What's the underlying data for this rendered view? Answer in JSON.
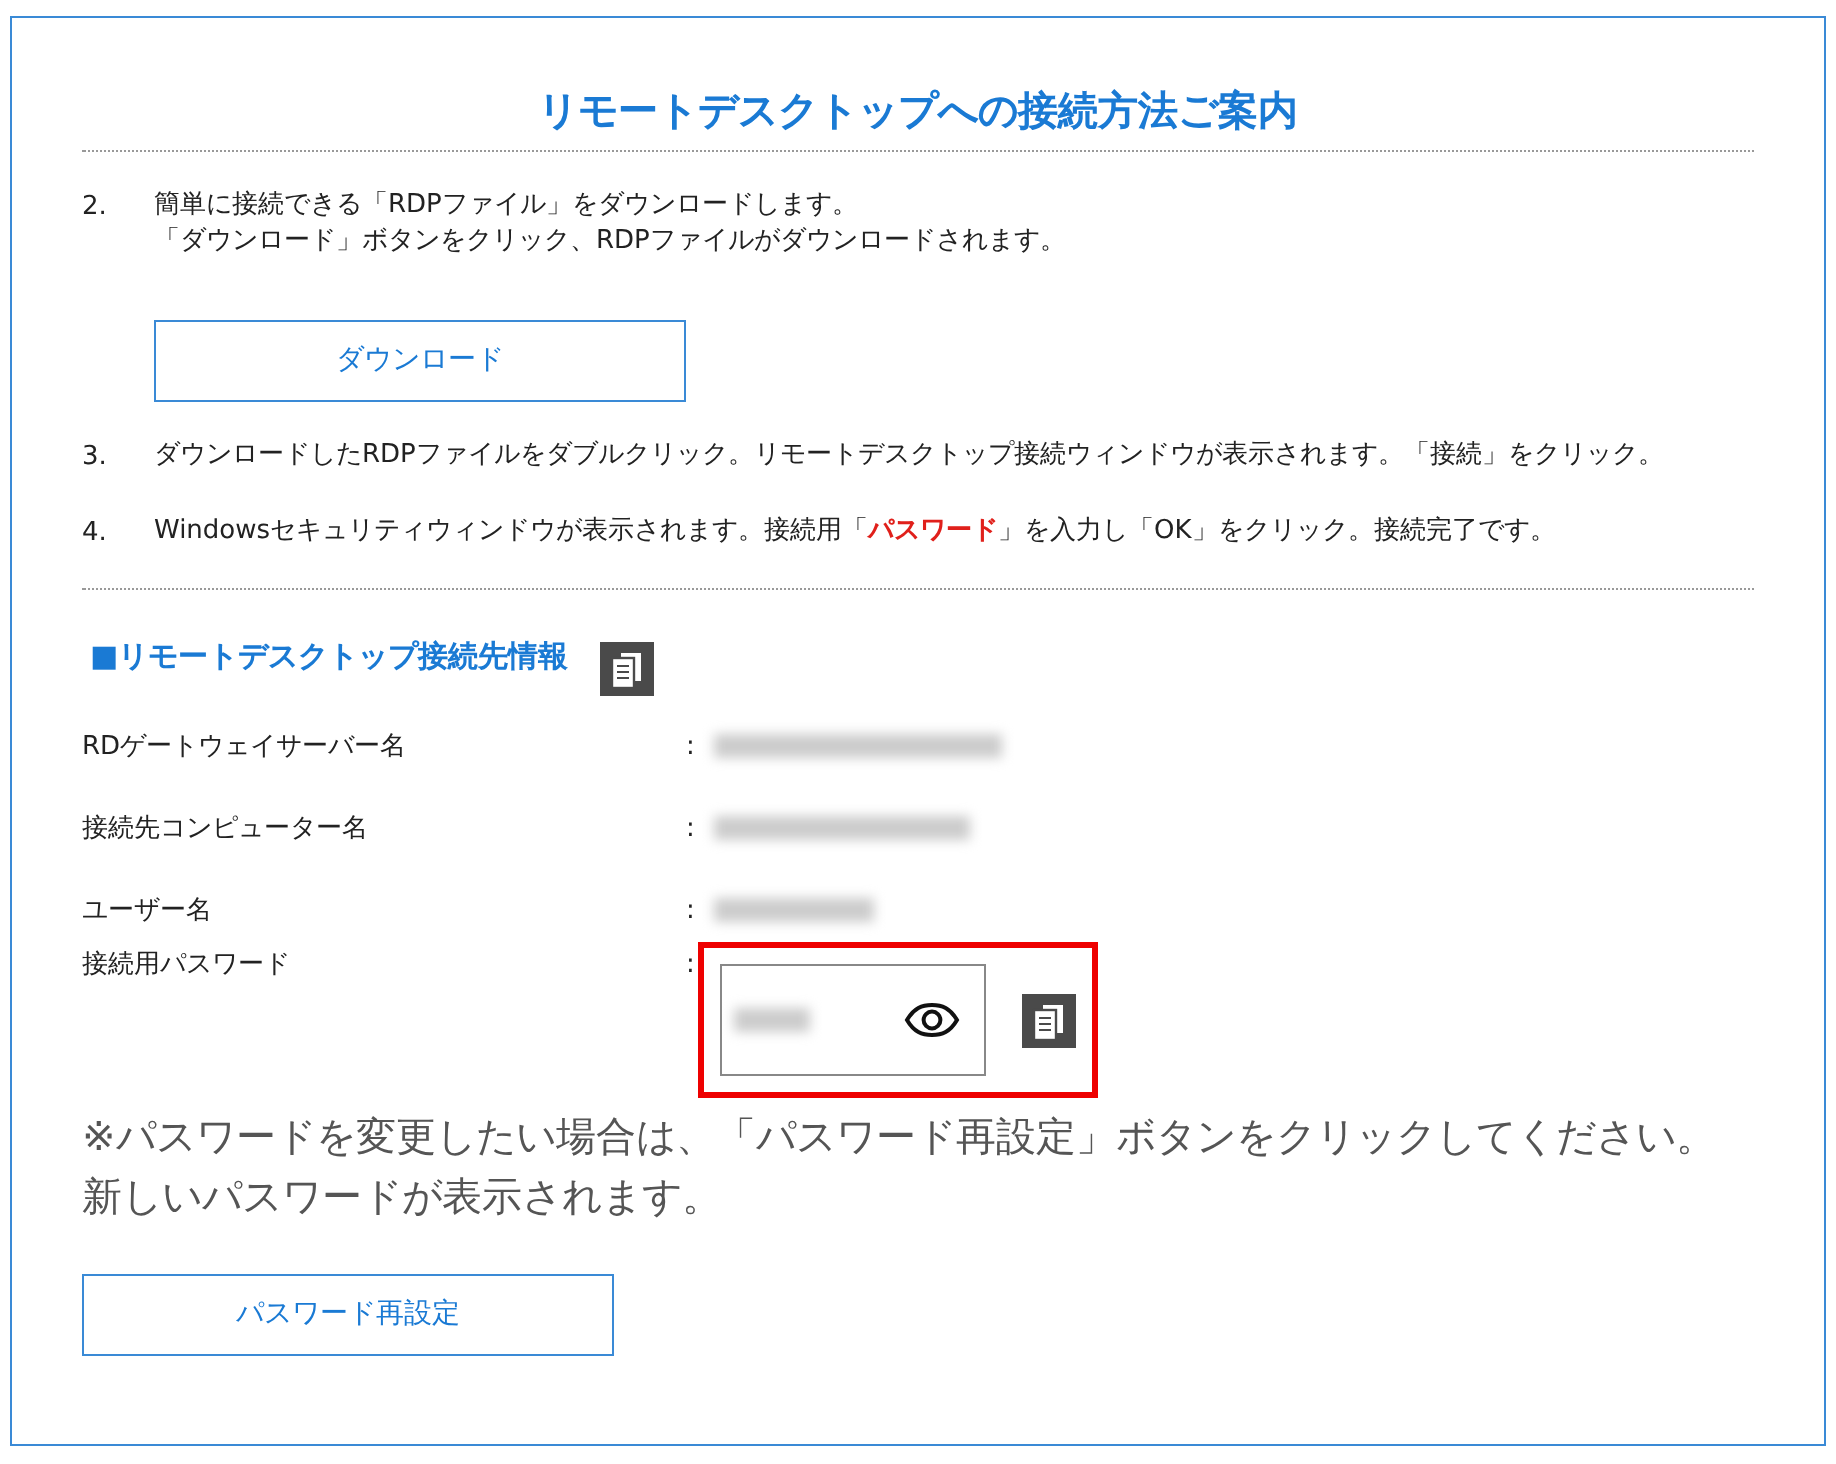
{
  "title": "リモートデスクトップへの接続方法ご案内",
  "steps": [
    {
      "number": "2.",
      "lines": [
        "簡単に接続できる「RDPファイル」をダウンロードします。",
        "「ダウンロード」ボタンをクリック、RDPファイルがダウンロードされます。"
      ],
      "button": "ダウンロード"
    },
    {
      "number": "3.",
      "lines": [
        "ダウンロードしたRDPファイルをダブルクリック。リモートデスクトップ接続ウィンドウが表示されます。「接続」をクリック。"
      ]
    },
    {
      "number": "4.",
      "lines": [
        "Windowsセキュリティウィンドウが表示されます。接続用「**パスワード**」を入力し「OK」をクリック。接続完了です。"
      ]
    }
  ],
  "info": {
    "heading": "■リモートデスクトップ接続先情報",
    "rows": [
      {
        "kind": "text",
        "label": "RDゲートウェイサーバー名",
        "separator": ":",
        "blurred": true
      },
      {
        "kind": "text",
        "label": "接続先コンピューター名",
        "separator": ":",
        "blurred": true
      },
      {
        "kind": "text",
        "label": "ユーザー名",
        "separator": ":",
        "blurred": true
      },
      {
        "kind": "password",
        "label": "接続用パスワード",
        "separator": ":",
        "blurred": true,
        "highlighted": true
      }
    ]
  },
  "note": "※パスワードを変更したい場合は、「パスワード再設定」ボタンをクリックしてください。新しいパスワードが表示されます。",
  "reset_button": "パスワード再設定"
}
